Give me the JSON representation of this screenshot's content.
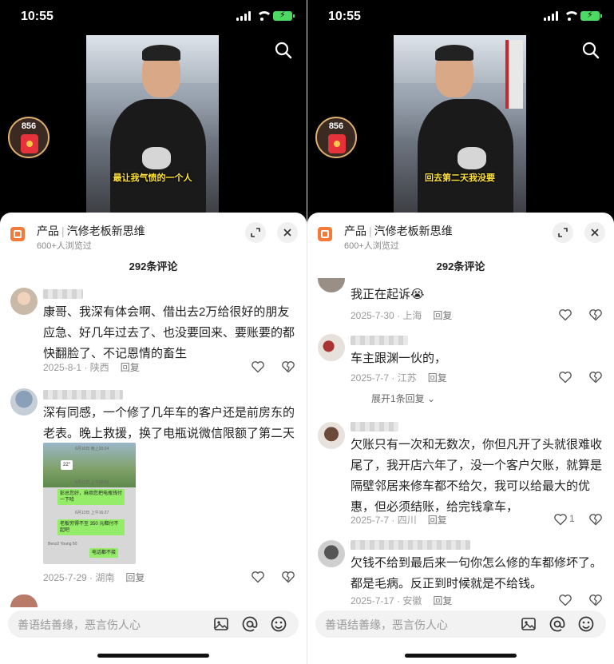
{
  "status": {
    "time": "10:55"
  },
  "left": {
    "badge": "856",
    "subtitle": "最让我气愤的一个人",
    "header": {
      "product": "产品",
      "title": "汽修老板新思维",
      "views": "600+人浏览过"
    },
    "comment_count": "292条评论",
    "comments": [
      {
        "text": "康哥、我深有体会啊、借出去2万给很好的朋友应急、好几年过去了、也没要回来、要账要的都快翻脸了、不记恩情的畜生",
        "date": "2025-8-1 · 陕西",
        "reply": "回复"
      },
      {
        "text": "深有同感，一个修了几年车的客户还是前房东的老表。晚上救援，换了电瓶说微信限额了第二天转。",
        "date": "2025-7-29 · 湖南",
        "reply": "回复"
      }
    ],
    "chat_image": {
      "lines": [
        "6月10日 晚上20:24",
        "22\"",
        "6月12日 上午08:33",
        "彭总您好，麻烦您把电瓶钱付一下哈",
        "6月13日 上午16:27",
        "老板穷得不至 350 元都付不起吧",
        "Benz2 Young 50",
        "电话都不接"
      ]
    },
    "input_placeholder": "善语结善缘，恶言伤人心"
  },
  "right": {
    "badge": "856",
    "subtitle": "回去第二天我没要",
    "header": {
      "product": "产品",
      "title": "汽修老板新思维",
      "views": "600+人浏览过"
    },
    "comment_count": "292条评论",
    "comments": [
      {
        "text": "我正在起诉😭",
        "date": "2025-7-30 · 上海",
        "reply": "回复"
      },
      {
        "text": "车主跟渊一伙的，",
        "date": "2025-7-7 · 江苏",
        "reply": "回复",
        "expand": "展开1条回复"
      },
      {
        "text": "欠账只有一次和无数次，你但凡开了头就很难收尾了，我开店六年了，没一个客户欠账，就算是隔壁邻居来修车都不给欠，我可以给最大的优惠，但必须结账，给完钱拿车，",
        "date": "2025-7-7 · 四川",
        "reply": "回复",
        "likes": "1"
      },
      {
        "text": "欠钱不给到最后来一句你怎么修的车都修坏了。都是毛病。反正到时候就是不给钱。",
        "date": "2025-7-17 · 安徽",
        "reply": "回复"
      }
    ],
    "input_placeholder": "善语结善缘，恶言伤人心"
  },
  "colors": {
    "accent_orange": "#f47a3a",
    "subtitle_yellow": "#ffe23a",
    "battery_green": "#4cd964"
  },
  "icons": [
    "search-icon",
    "red-envelope-icon",
    "expand-icon",
    "close-icon",
    "heart-icon",
    "broken-heart-icon",
    "image-icon",
    "at-icon",
    "emoji-icon"
  ]
}
